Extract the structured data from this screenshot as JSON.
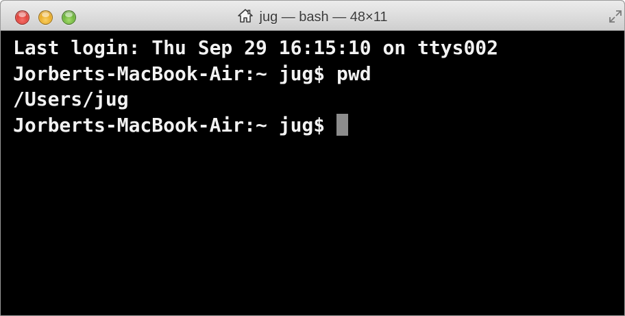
{
  "window": {
    "title": "jug — bash — 48×11",
    "title_icon": "home-icon",
    "colors": {
      "close": "#dd3b34",
      "minimize": "#e8a71d",
      "zoom": "#64ae33",
      "terminal_background": "#000000",
      "terminal_text": "#f2f2f2",
      "cursor": "#8c8c8c"
    }
  },
  "terminal": {
    "lines": [
      "Last login: Thu Sep 29 16:15:10 on ttys002",
      "Jorberts-MacBook-Air:~ jug$ pwd",
      "/Users/jug"
    ],
    "prompt": "Jorberts-MacBook-Air:~ jug$"
  }
}
